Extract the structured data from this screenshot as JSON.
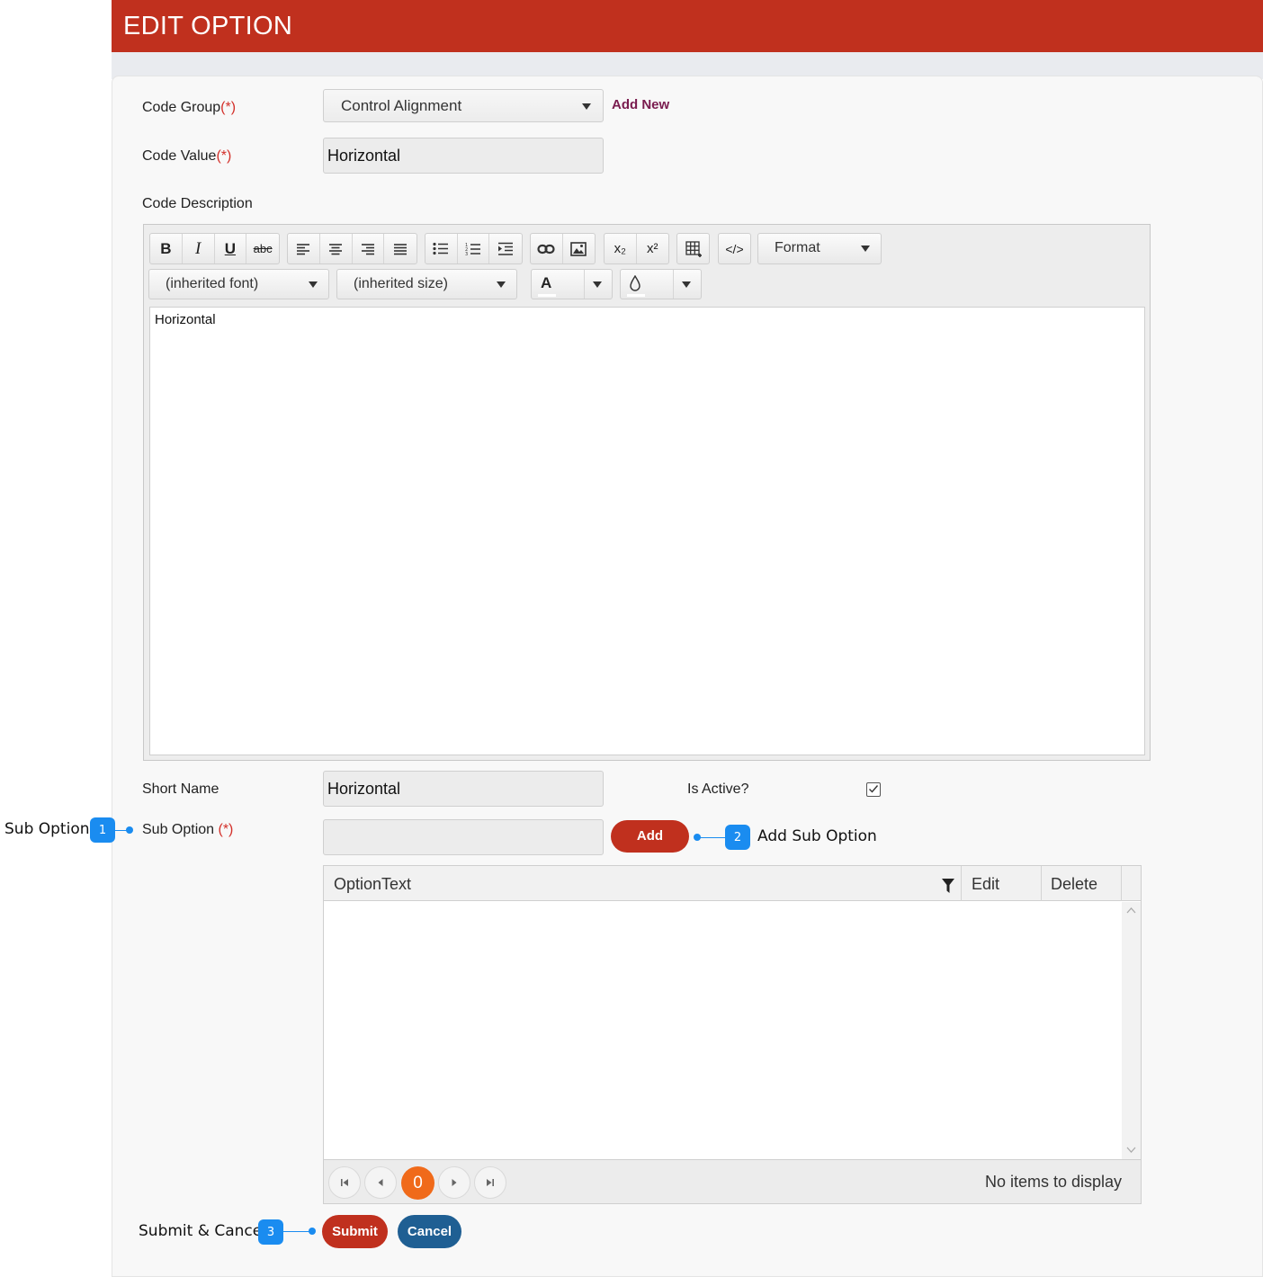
{
  "header": {
    "title": "EDIT OPTION"
  },
  "form": {
    "code_group": {
      "label": "Code Group",
      "required": "(*)",
      "value": "Control Alignment",
      "add_new": "Add New"
    },
    "code_value": {
      "label": "Code Value",
      "required": "(*)",
      "value": "Horizontal"
    },
    "code_description": {
      "label": "Code Description"
    },
    "short_name": {
      "label": "Short Name",
      "value": "Horizontal"
    },
    "is_active": {
      "label": "Is Active?",
      "checked": true
    },
    "sub_option": {
      "label": "Sub Option ",
      "required": "(*)",
      "value": "",
      "add_label": "Add"
    }
  },
  "editor": {
    "toolbar": {
      "bold": "B",
      "italic": "I",
      "underline": "U",
      "strike": "abc",
      "subscript": "x₂",
      "superscript": "x²",
      "view_html": "</>",
      "format": "Format",
      "font": "(inherited font)",
      "size": "(inherited size)",
      "fore_color_letter": "A"
    },
    "content": "Horizontal"
  },
  "grid": {
    "columns": [
      "OptionText",
      "Edit",
      "Delete"
    ],
    "current_page": "0",
    "empty_text": "No items to display"
  },
  "actions": {
    "submit": "Submit",
    "cancel": "Cancel"
  },
  "annotations": [
    {
      "number": "1",
      "text": "Sub Option"
    },
    {
      "number": "2",
      "text": "Add Sub Option"
    },
    {
      "number": "3",
      "text": "Submit & Cancel"
    }
  ],
  "colors": {
    "header": "#c0301e",
    "primary_red": "#c0301e",
    "cancel_blue": "#1f5f93",
    "pager_active": "#f06a1a",
    "annotation": "#1a8cf0",
    "required": "#d3302a",
    "link": "#7a1c4f"
  }
}
